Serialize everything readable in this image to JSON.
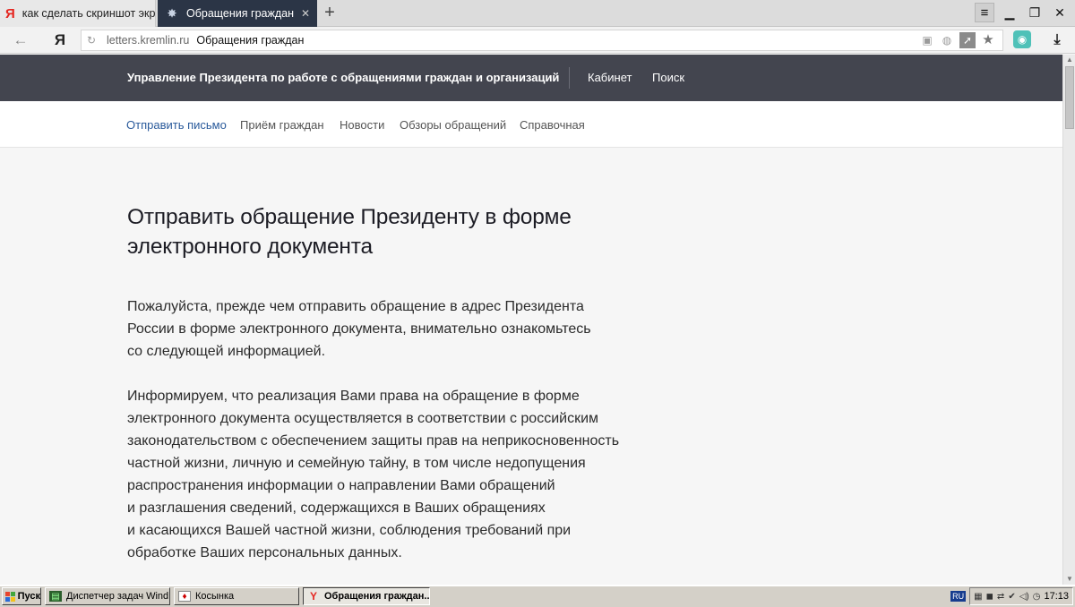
{
  "browser": {
    "tabs": [
      {
        "label": "как сделать скриншот экра",
        "favicon": "yandex-logo-icon"
      },
      {
        "label": "Обращения граждан",
        "favicon": "coat-of-arms-icon"
      }
    ],
    "address": {
      "domain": "letters.kremlin.ru",
      "page_title": "Обращения граждан"
    }
  },
  "site": {
    "header": {
      "org_title": "Управление Президента по работе с обращениями граждан и организаций",
      "links": [
        "Кабинет",
        "Поиск"
      ]
    },
    "subnav": [
      "Отправить письмо",
      "Приём граждан",
      "Новости",
      "Обзоры обращений",
      "Справочная"
    ],
    "main": {
      "heading_lines": [
        "Отправить обращение Президенту в форме",
        "электронного документа"
      ],
      "paragraph1_lines": [
        "Пожалуйста, прежде чем отправить обращение в адрес Президента",
        "России в форме электронного документа, внимательно ознакомьтесь",
        "со следующей информацией."
      ],
      "paragraph2_lines": [
        "Информируем, что реализация Вами права на обращение в форме",
        "электронного документа осуществляется в соответствии с российским",
        "законодательством с обеспечением защиты прав на неприкосновенность",
        "частной жизни, личную и семейную тайну, в том числе недопущения",
        "распространения информации о направлении Вами обращений",
        "и разглашения сведений, содержащихся в Ваших обращениях",
        "и касающихся Вашей частной жизни, соблюдения требований при",
        "обработке Ваших персональных данных."
      ]
    }
  },
  "taskbar": {
    "start_label": "Пуск",
    "tasks": [
      {
        "label": "Диспетчер задач Wind...",
        "icon": "task-manager-icon"
      },
      {
        "label": "Косынка",
        "icon": "solitaire-icon"
      },
      {
        "label": "Обращения граждан...",
        "icon": "yandex-browser-icon"
      }
    ],
    "lang": "RU",
    "clock": "17:13"
  },
  "colors": {
    "site_header_bg": "#43454f",
    "active_tab_bg": "#2b3546",
    "link_active": "#2a5a9b",
    "page_bg": "#f6f6f6"
  }
}
